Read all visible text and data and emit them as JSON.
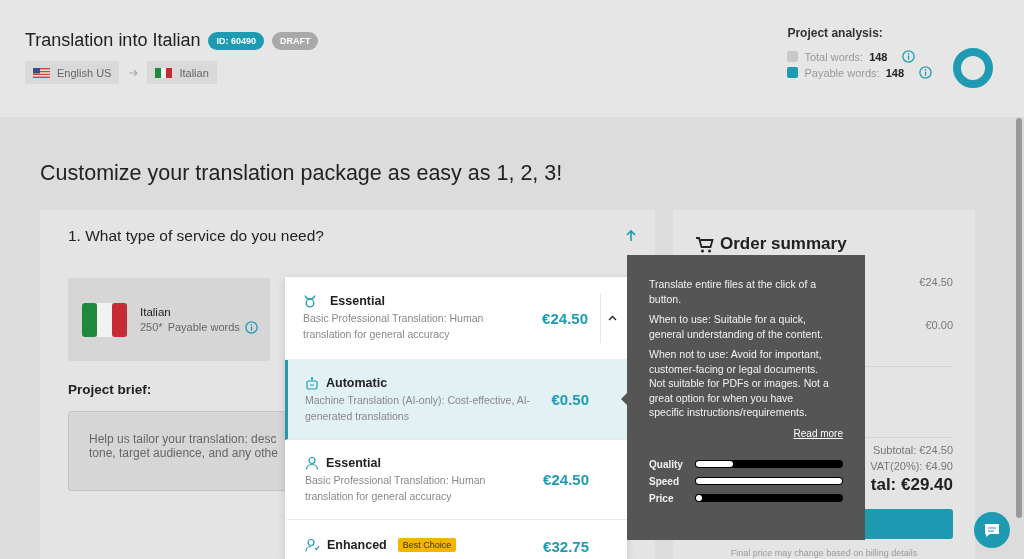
{
  "header": {
    "title": "Translation into Italian",
    "id_badge": "ID: 60490",
    "status_badge": "DRAFT",
    "source_language": "English US",
    "target_language": "Italian"
  },
  "analysis": {
    "title": "Project analysis:",
    "rows": [
      {
        "label": "Total words:",
        "value": "148",
        "color": "#c8c8c8"
      },
      {
        "label": "Payable words:",
        "value": "148",
        "color": "#1e9bb3"
      }
    ]
  },
  "heading": "Customize your translation package as easy as 1, 2, 3!",
  "service": {
    "title": "1. What type of service do you need?",
    "expanded": true,
    "language": "Italian",
    "word_count": "250*",
    "word_label": "Payable words",
    "brief_label": "Project brief:",
    "brief_placeholder": "Help us tailor your translation: desc\ntone, target audience, and any othe"
  },
  "dropdown": {
    "current": {
      "title": "Essential",
      "description": "Basic Professional Translation: Human translation for general accuracy",
      "price": "€24.50"
    },
    "options": [
      {
        "kind": "machine",
        "title": "Automatic",
        "description": "Machine Translation (AI-only): Cost-effective, AI-generated translations",
        "price": "€0.50",
        "selected": true
      },
      {
        "kind": "human",
        "title": "Essential",
        "description": "Basic Professional Translation: Human translation for general accuracy",
        "price": "€24.50",
        "selected": false
      },
      {
        "kind": "expert",
        "title": "Enhanced",
        "badge": "Best Choice",
        "price": "€32.75",
        "selected": false
      }
    ]
  },
  "tooltip": {
    "paragraphs": [
      "Translate entire files at the click of a button.",
      "When to use: Suitable for a quick, general understanding of the content.",
      "When not to use: Avoid for important, customer-facing or legal documents. Not suitable for PDFs or images. Not a great option for when you have specific instructions/requirements."
    ],
    "link": "Read more",
    "metrics": [
      {
        "label": "Quality",
        "level": 0.25
      },
      {
        "label": "Speed",
        "level": 1
      },
      {
        "label": "Price",
        "level": 0.03
      }
    ]
  },
  "summary": {
    "title": "Order summary",
    "lines": [
      "€24.50",
      "€0.00"
    ],
    "subtotal": "Subtotal: €24.50",
    "vat": "VAT(20%): €4.90",
    "total": "tal: €29.40",
    "note": "Final price may change based on billing details"
  }
}
